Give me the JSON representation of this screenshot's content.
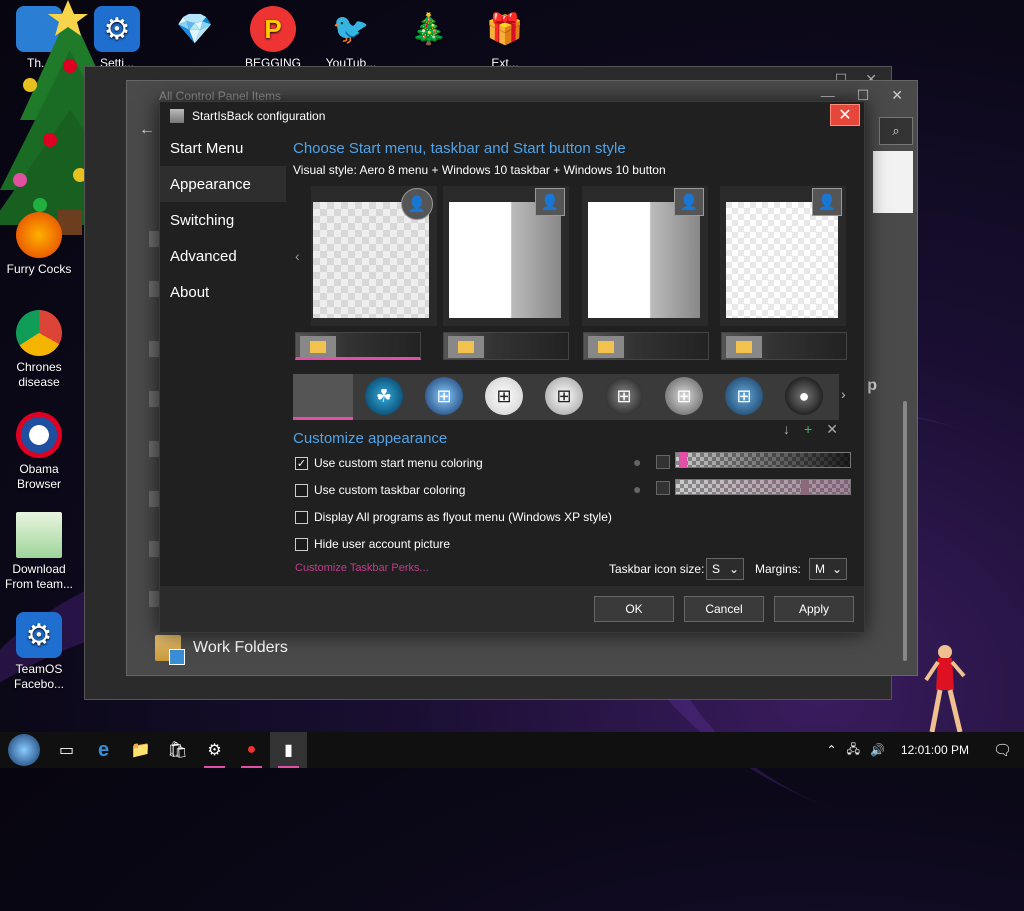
{
  "desktop": {
    "icons": [
      {
        "label": "Th...",
        "glyph": "🖥"
      },
      {
        "label": "Setti...",
        "glyph": "⚙"
      },
      {
        "label": "",
        "glyph": "💎"
      },
      {
        "label": "BEGGING LOL",
        "glyph": "P"
      },
      {
        "label": "YouTub...",
        "glyph": "🐦"
      },
      {
        "label": "",
        "glyph": "🎄"
      },
      {
        "label": "Ext...",
        "glyph": "🎁"
      },
      {
        "label": "Furry Cocks",
        "glyph": "🦊"
      },
      {
        "label": "Chrones disease",
        "glyph": "◉"
      },
      {
        "label": "Obama Browser",
        "glyph": "◎"
      },
      {
        "label": "Download From team...",
        "glyph": "📄"
      },
      {
        "label": "TeamOS Facebo...",
        "glyph": "⚙"
      }
    ]
  },
  "background_window": {
    "title": "All Control Panel Items",
    "back_glyph": "←",
    "search_glyph": "⌕",
    "controls": [
      "—",
      "☐",
      "✕"
    ],
    "partial_text": "p",
    "work_folders": "Work Folders"
  },
  "dialog": {
    "title": "StartIsBack configuration",
    "close_glyph": "✕",
    "sidebar": [
      {
        "label": "Start Menu",
        "active": false
      },
      {
        "label": "Appearance",
        "active": true
      },
      {
        "label": "Switching",
        "active": false
      },
      {
        "label": "Advanced",
        "active": false
      },
      {
        "label": "About",
        "active": false
      }
    ],
    "heading": "Choose Start menu, taskbar and Start button style",
    "visual_style": "Visual style:  Aero 8 menu + Windows 10 taskbar + Windows 10 button",
    "customize_heading": "Customize appearance",
    "options": [
      {
        "label": "Use custom start menu coloring",
        "checked": true
      },
      {
        "label": "Use custom taskbar coloring",
        "checked": false
      },
      {
        "label": "Display All programs as flyout menu (Windows XP style)",
        "checked": false
      },
      {
        "label": "Hide user account picture",
        "checked": false
      }
    ],
    "slider_levels": [
      0.02,
      0.75
    ],
    "customize_link": "Customize Taskbar Perks...",
    "taskbar_icon_size_label": "Taskbar icon size:",
    "taskbar_icon_size_value": "S",
    "margins_label": "Margins:",
    "margins_value": "M",
    "ok": "OK",
    "cancel": "Cancel",
    "apply": "Apply",
    "accent": "#e24fa8"
  },
  "taskbar": {
    "items": [
      {
        "name": "start-orb",
        "glyph": "⊞"
      },
      {
        "name": "task-view",
        "glyph": "▭"
      },
      {
        "name": "edge",
        "glyph": "e"
      },
      {
        "name": "file-explorer",
        "glyph": "📁"
      },
      {
        "name": "store",
        "glyph": "🛍"
      },
      {
        "name": "settings",
        "glyph": "⚙"
      },
      {
        "name": "app-red",
        "glyph": "●"
      },
      {
        "name": "startisback",
        "glyph": "▮"
      }
    ],
    "clock": "12:01:00 PM"
  }
}
